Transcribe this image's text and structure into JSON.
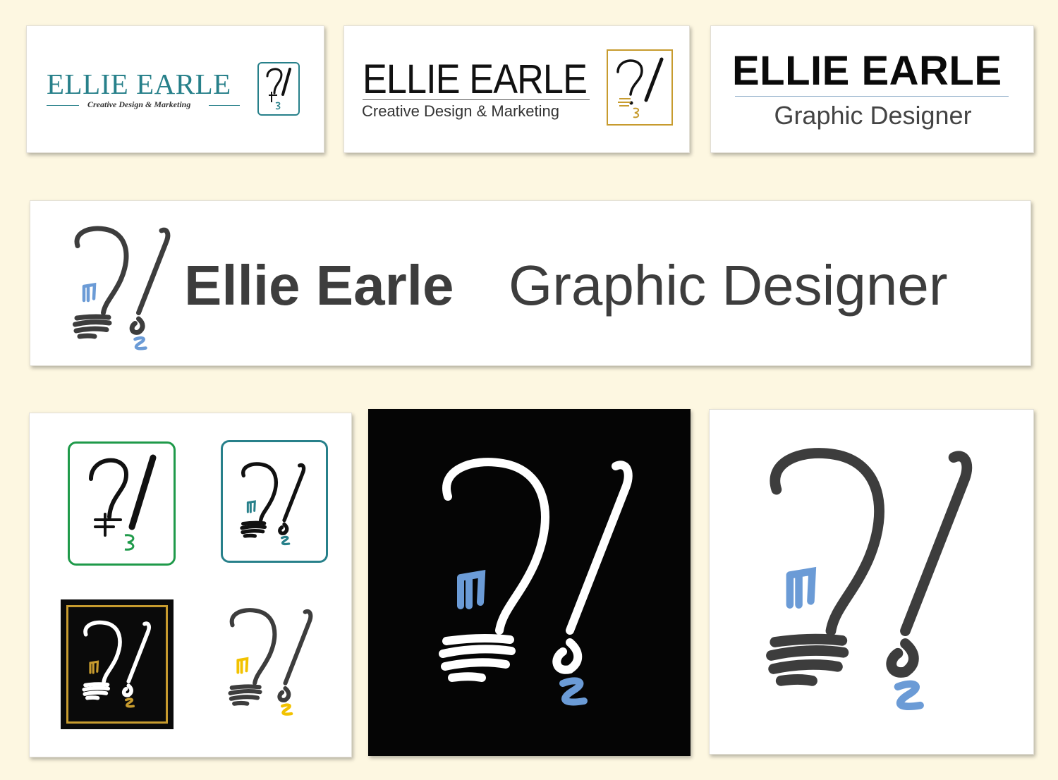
{
  "colors": {
    "page_background": "#fdf7e1",
    "teal": "#27808a",
    "gold": "#c79b2e",
    "green": "#1f9a4a",
    "blue": "#6b9bd6",
    "yellow": "#f2c200",
    "charcoal": "#3d3d3d",
    "black": "#0a0a0a",
    "white": "#ffffff"
  },
  "card1": {
    "name": "ELLIE EARLE",
    "tagline": "Creative Design & Marketing",
    "icon": "question-exclamation-mark-icon"
  },
  "card2": {
    "name": "ELLIE EARLE",
    "tagline": "Creative Design & Marketing",
    "icon": "question-exclamation-mark-icon"
  },
  "card3": {
    "name": "ELLIE EARLE",
    "tagline": "Graphic Designer"
  },
  "banner": {
    "name": "Ellie Earle",
    "title": "Graphic Designer",
    "icon": "lightbulb-paintbrush-icon"
  },
  "icon_grid": {
    "icons": [
      "question-exclamation-mark-icon",
      "lightbulb-paintbrush-icon",
      "lightbulb-paintbrush-icon",
      "lightbulb-paintbrush-icon"
    ]
  },
  "dark_logo": {
    "icon": "lightbulb-paintbrush-icon"
  },
  "light_logo": {
    "icon": "lightbulb-paintbrush-icon"
  }
}
